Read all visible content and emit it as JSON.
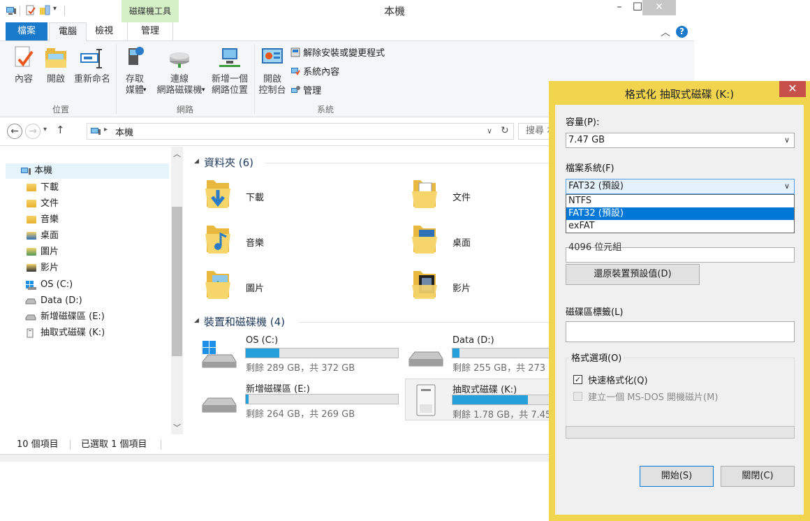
{
  "window": {
    "title": "本機",
    "contextual_tab_group": "磁碟機工具",
    "minimize": "–",
    "maximize": "☐",
    "close": "✕"
  },
  "ribbon": {
    "tabs": [
      "檔案",
      "電腦",
      "檢視",
      "管理"
    ],
    "help": "?",
    "groups": {
      "location": {
        "label": "位置",
        "properties": "內容",
        "open": "開啟",
        "rename": "重新命名"
      },
      "network": {
        "label": "網路",
        "access_media_1": "存取",
        "access_media_2": "媒體",
        "map_drive_1": "連線",
        "map_drive_2": "網路磁碟機",
        "add_location_1": "新增一個",
        "add_location_2": "網路位置"
      },
      "system": {
        "label": "系統",
        "open_cp_1": "開啟",
        "open_cp_2": "控制台",
        "uninstall": "解除安裝或變更程式",
        "sys_props": "系統內容",
        "manage": "管理"
      }
    }
  },
  "address": {
    "path": "本機",
    "search_placeholder": "搜尋 本"
  },
  "nav_pane": {
    "items": [
      {
        "label": "本機",
        "icon": "computer-icon"
      },
      {
        "label": "下載",
        "icon": "downloads-folder-icon"
      },
      {
        "label": "文件",
        "icon": "documents-folder-icon"
      },
      {
        "label": "音樂",
        "icon": "music-folder-icon"
      },
      {
        "label": "桌面",
        "icon": "desktop-folder-icon"
      },
      {
        "label": "圖片",
        "icon": "pictures-folder-icon"
      },
      {
        "label": "影片",
        "icon": "videos-folder-icon"
      },
      {
        "label": "OS (C:)",
        "icon": "windows-drive-icon"
      },
      {
        "label": "Data (D:)",
        "icon": "drive-icon"
      },
      {
        "label": "新增磁碟區 (E:)",
        "icon": "drive-icon"
      },
      {
        "label": "抽取式磁碟 (K:)",
        "icon": "removable-drive-icon"
      }
    ]
  },
  "content": {
    "folders_header": "資料夾 (6)",
    "folders": [
      "下載",
      "文件",
      "音樂",
      "桌面",
      "圖片",
      "影片"
    ],
    "drives_header": "裝置和磁碟機 (4)",
    "drives": [
      {
        "name": "OS (C:)",
        "sub": "剩餘 289 GB，共 372 GB",
        "used_fraction": 0.22
      },
      {
        "name": "Data (D:)",
        "sub": "剩餘 255 GB，共 273 G",
        "used_fraction": 0.07
      },
      {
        "name": "新增磁碟區 (E:)",
        "sub": "剩餘 264 GB，共 269 GB",
        "used_fraction": 0.02
      },
      {
        "name": "抽取式磁碟 (K:)",
        "sub": "剩餘 1.78 GB，共 7.45",
        "used_fraction": 0.76
      }
    ]
  },
  "status": {
    "items": "10 個項目",
    "selected": "已選取 1 個項目"
  },
  "dialog": {
    "title": "格式化 抽取式磁碟 (K:)",
    "close": "✕",
    "capacity_label": "容量(P):",
    "capacity_value": "7.47 GB",
    "fs_label": "檔案系統(F)",
    "fs_value": "FAT32 (預設)",
    "fs_options": [
      "NTFS",
      "FAT32 (預設)",
      "exFAT"
    ],
    "fs_selected_index": 1,
    "alloc_partial": "4096 位元組",
    "restore_button": "還原裝置預設值(D)",
    "volume_label": "磁碟區標籤(L)",
    "volume_value": "",
    "options_label": "格式選項(O)",
    "quick_format": "快速格式化(Q)",
    "quick_format_checked": true,
    "msdos_disk": "建立一個 MS-DOS 開機磁片(M)",
    "msdos_checked": false,
    "progress_fraction": 0,
    "start_button": "開始(S)",
    "close_button": "關閉(C)"
  }
}
